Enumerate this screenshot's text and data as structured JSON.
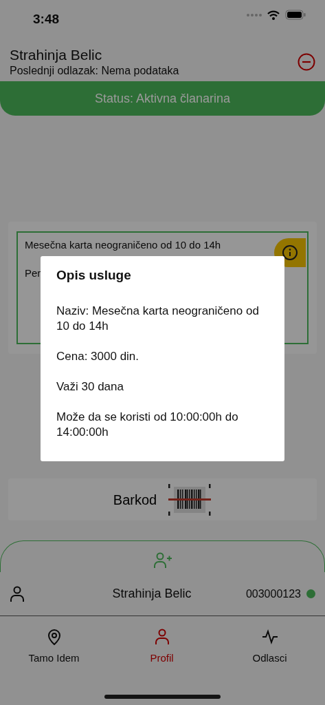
{
  "status_bar": {
    "time": "3:48"
  },
  "header": {
    "name": "Strahinja Belic",
    "last_visit": "Poslednji odlazak: Nema podataka"
  },
  "status_banner": {
    "text": "Status: Aktivna članarina",
    "active": true
  },
  "membership_card": {
    "title": "Mesečna karta neograničeno od 10 do 14h",
    "detail": "Per",
    "active": true
  },
  "modal": {
    "title": "Opis usluge",
    "lines": [
      "Naziv: Mesečna karta neograničeno od 10 do 14h",
      "Cena: 3000 din.",
      "Važi 30 dana",
      "Može da se koristi od 10:00:00h do 14:00:00h"
    ]
  },
  "barcode_button": {
    "label": "Barkod"
  },
  "member_row": {
    "name": "Strahinja Belic",
    "number": "003000123",
    "active": true
  },
  "tabs": [
    {
      "label": "Tamo Idem",
      "selected": false
    },
    {
      "label": "Profil",
      "selected": true
    },
    {
      "label": "Odlasci",
      "selected": false
    }
  ]
}
